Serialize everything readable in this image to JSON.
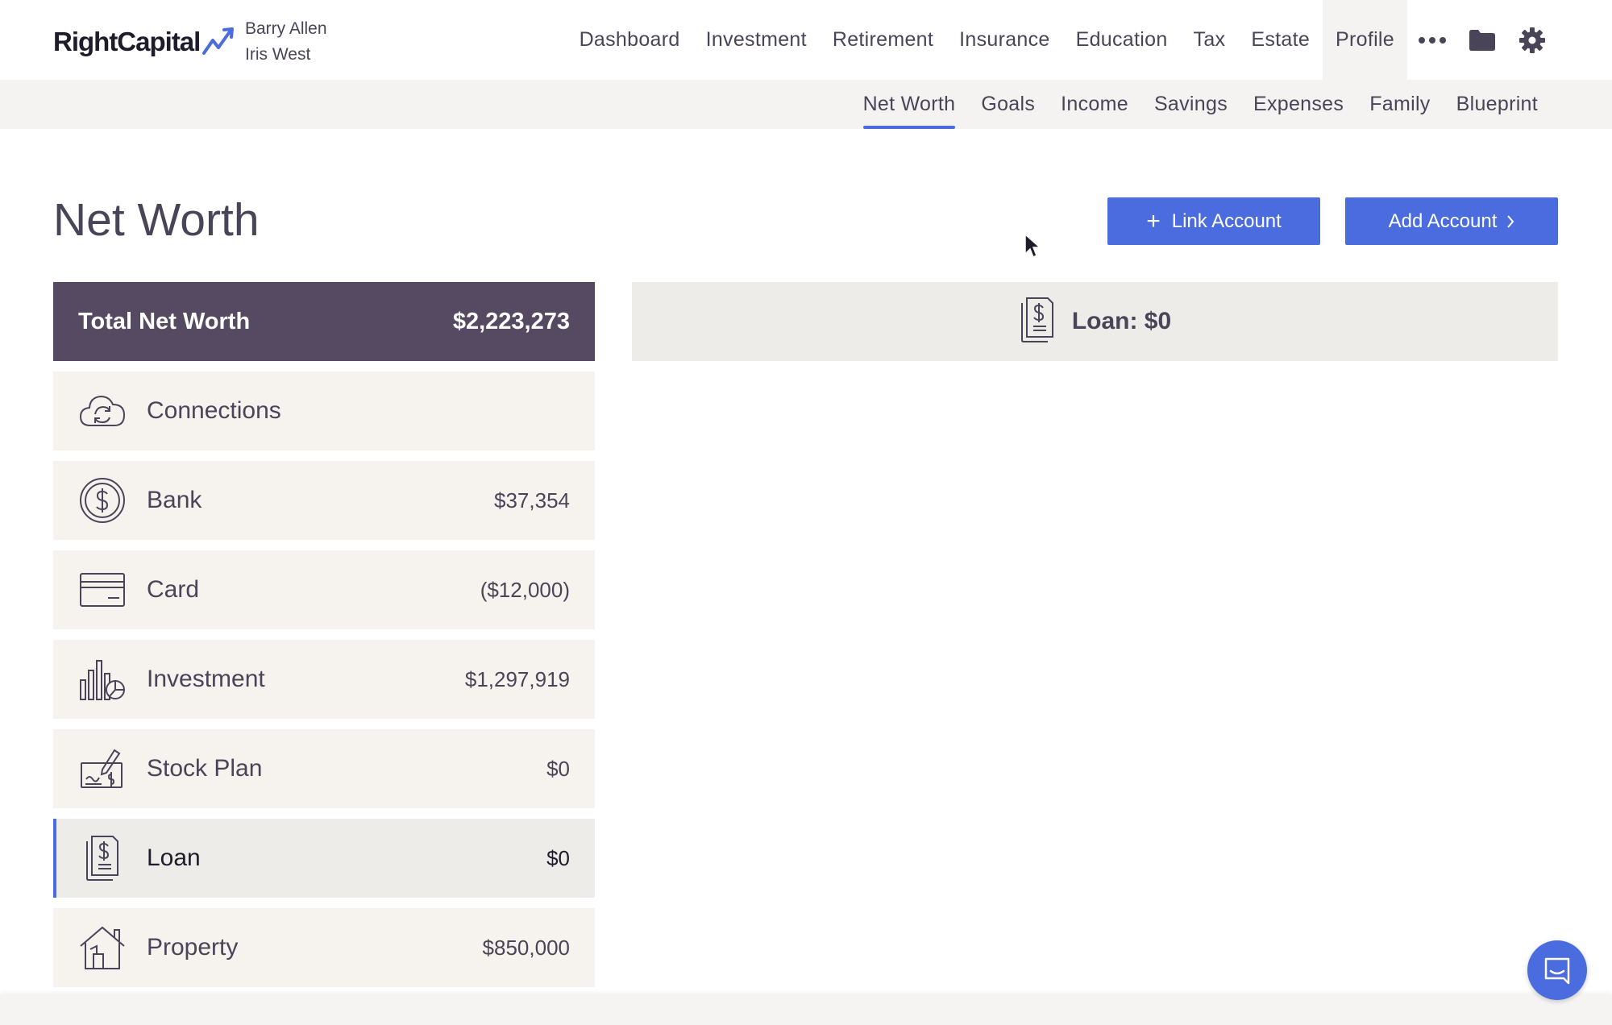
{
  "brand": {
    "name": "RightCapital"
  },
  "clients": [
    "Barry Allen",
    "Iris West"
  ],
  "nav": {
    "items": [
      {
        "label": "Dashboard"
      },
      {
        "label": "Investment"
      },
      {
        "label": "Retirement"
      },
      {
        "label": "Insurance"
      },
      {
        "label": "Education"
      },
      {
        "label": "Tax"
      },
      {
        "label": "Estate"
      },
      {
        "label": "Profile",
        "active": true
      }
    ],
    "icons": [
      "more-icon",
      "folder-icon",
      "gear-icon"
    ]
  },
  "subnav": {
    "items": [
      {
        "label": "Net Worth",
        "active": true
      },
      {
        "label": "Goals"
      },
      {
        "label": "Income"
      },
      {
        "label": "Savings"
      },
      {
        "label": "Expenses"
      },
      {
        "label": "Family"
      },
      {
        "label": "Blueprint"
      }
    ]
  },
  "page": {
    "title": "Net Worth",
    "link_account_label": "Link Account",
    "add_account_label": "Add Account"
  },
  "summary": {
    "label": "Total Net Worth",
    "value": "$2,223,273"
  },
  "categories": [
    {
      "label": "Connections",
      "value": "",
      "icon": "cloud-sync-icon"
    },
    {
      "label": "Bank",
      "value": "$37,354",
      "icon": "dollar-coin-icon"
    },
    {
      "label": "Card",
      "value": "($12,000)",
      "icon": "credit-card-icon"
    },
    {
      "label": "Investment",
      "value": "$1,297,919",
      "icon": "investment-chart-icon"
    },
    {
      "label": "Stock Plan",
      "value": "$0",
      "icon": "stock-plan-check-icon"
    },
    {
      "label": "Loan",
      "value": "$0",
      "icon": "loan-document-icon",
      "selected": true
    },
    {
      "label": "Property",
      "value": "$850,000",
      "icon": "house-icon"
    }
  ],
  "detail": {
    "title": "Loan: $0",
    "icon": "loan-document-icon"
  },
  "colors": {
    "accent": "#4a6cdf",
    "summary_bg": "#564a62",
    "row_bg": "#f6f3ef",
    "text": "#4a4458"
  }
}
